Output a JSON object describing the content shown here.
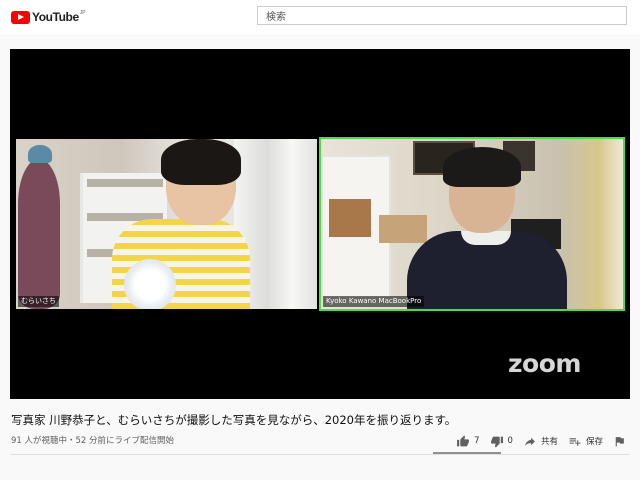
{
  "header": {
    "logo_text": "YouTube",
    "logo_region": "JP",
    "search_placeholder": "検索"
  },
  "video": {
    "participants": [
      {
        "name": "むらいさち",
        "highlighted": false
      },
      {
        "name": "Kyoko Kawano MacBookPro",
        "highlighted": true
      }
    ],
    "watermark": "zoom",
    "highlight_color": "#52d94a"
  },
  "info": {
    "title": "写真家 川野恭子と、むらいさちが撮影した写真を見ながら、2020年を振り返ります。",
    "views_line": "91 人が視聴中・52 分前にライブ配信開始"
  },
  "actions": {
    "like_count": "7",
    "dislike_count": "0",
    "share_label": "共有",
    "save_label": "保存"
  },
  "icons": {
    "like": "thumbs-up-icon",
    "dislike": "thumbs-down-icon",
    "share": "share-icon",
    "save": "add-to-playlist-icon",
    "report": "flag-icon"
  },
  "colors": {
    "brand_red": "#ff0000",
    "page_bg": "#f9f9f9"
  }
}
